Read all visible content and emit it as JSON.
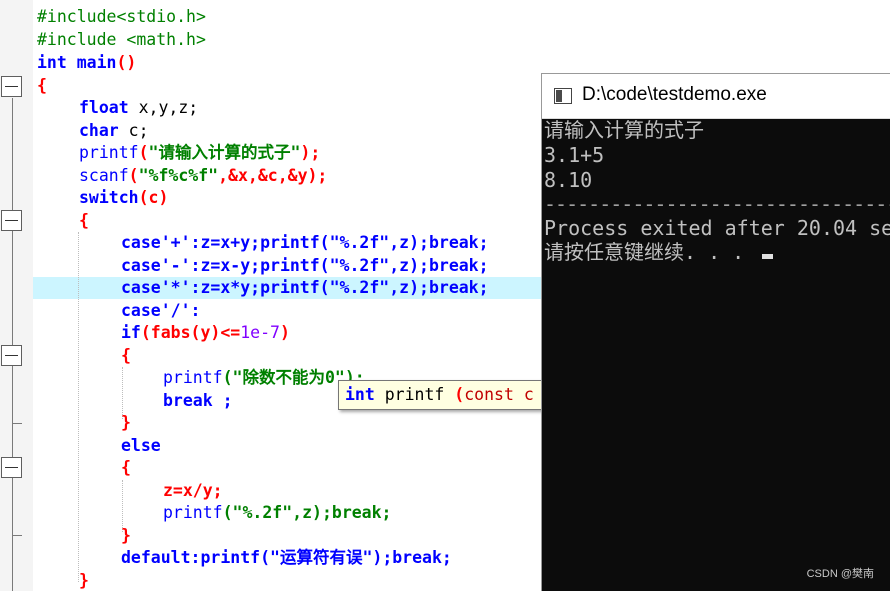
{
  "editor": {
    "lines": {
      "l1": "#include<stdio.h>",
      "l2": "#include <math.h>",
      "l3_type": "int",
      "l3_fn": " main",
      "l3_paren": "()",
      "l4": "{",
      "l5_type": "float",
      "l5_rest": " x,y,z;",
      "l6_type": "char",
      "l6_rest": " c;",
      "l7_fn": "printf",
      "l7_open": "(",
      "l7_str": "\"请输入计算的式子\"",
      "l7_close": ");",
      "l8_fn": "scanf",
      "l8_open": "(",
      "l8_str": "\"%f%c%f\"",
      "l8_rest": ",&x,&c,&y);",
      "l9_kw": "switch",
      "l9_rest": "(c)",
      "l10": "{",
      "l11": "case'+':z=x+y;printf(\"%.2f\",z);break;",
      "l12": "case'-':z=x-y;printf(\"%.2f\",z);break;",
      "l13": "case'*':z=x*y;printf(\"%.2f\",z);break;",
      "l14": "case'/':",
      "l15_kw": "if",
      "l15_a": "(fabs(y)<=",
      "l15_num": "1e-7",
      "l15_b": ")",
      "l16": "{",
      "l17_fn": "printf",
      "l17_str": "(\"除数不能为0\");",
      "l18": "break ;",
      "l19": "}",
      "l20": "else",
      "l21": "{",
      "l22": "z=x/y;",
      "l23_fn": "printf",
      "l23_str": "(\"%.2f\",z);break;",
      "l24": "}",
      "l25_kw": "default",
      "l25_rest": ":printf(\"运算符有误\");break;",
      "l26": "}"
    },
    "tooltip": {
      "type": "int",
      "name": " printf",
      "open": " (",
      "kw": "const c"
    }
  },
  "console": {
    "title": "D:\\code\\testdemo.exe",
    "lines": [
      "请输入计算的式子",
      "3.1+5",
      "8.10",
      "--------------------------------",
      "Process exited after 20.04 se",
      "请按任意键继续. . . "
    ]
  },
  "watermark": "CSDN @樊南",
  "colors": {
    "keyword": "#0000ff",
    "string": "#008000",
    "operator": "#ff0000",
    "highlight_line": "#ccf5ff",
    "console_bg": "#0c0c0c",
    "console_text": "#c0c0c0"
  }
}
